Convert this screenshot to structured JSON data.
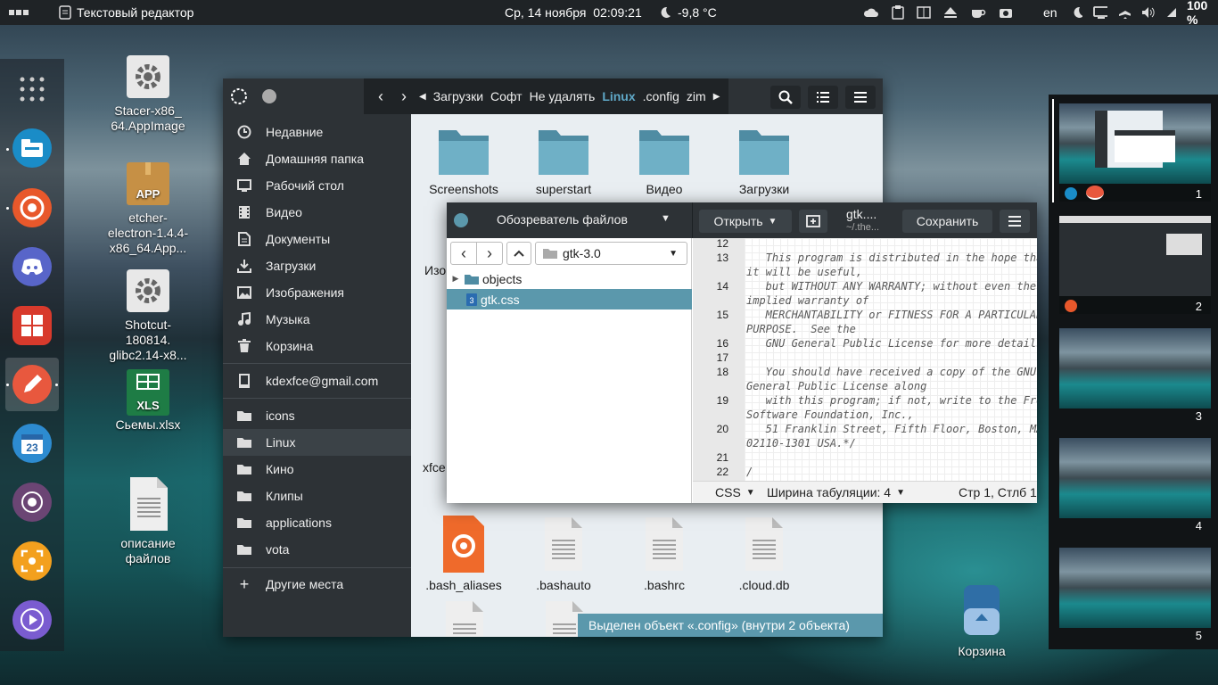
{
  "topbar": {
    "app_title": "Текстовый редактор",
    "datetime": "Ср, 14 ноября  02:09:21",
    "weather": "-9,8 °C",
    "lang": "en",
    "battery": "100 %"
  },
  "desktop": {
    "icons": [
      {
        "label": "Stacer-x86_\n64.AppImage"
      },
      {
        "label": "etcher-\nelectron-1.4.4-\nx86_64.App...",
        "badge": "APP"
      },
      {
        "label": "Shotcut-\n180814.\nglibc2.14-x8..."
      },
      {
        "label": "Сьемы.xlsx",
        "badge": "XLS"
      },
      {
        "label": "описание\nфайлов"
      }
    ],
    "trash_label": "Корзина"
  },
  "filemanager": {
    "breadcrumbs": [
      "Загрузки",
      "Софт",
      "Не удалять",
      "Linux",
      ".config",
      "zim"
    ],
    "active_crumb": "Linux",
    "sidebar": [
      {
        "label": "Недавние",
        "icon": "clock-icon"
      },
      {
        "label": "Домашняя папка",
        "icon": "home-icon"
      },
      {
        "label": "Рабочий стол",
        "icon": "desktop-icon"
      },
      {
        "label": "Видео",
        "icon": "video-icon"
      },
      {
        "label": "Документы",
        "icon": "document-icon"
      },
      {
        "label": "Загрузки",
        "icon": "download-icon"
      },
      {
        "label": "Изображения",
        "icon": "image-icon"
      },
      {
        "label": "Музыка",
        "icon": "music-icon"
      },
      {
        "label": "Корзина",
        "icon": "trash-icon"
      }
    ],
    "account": "kdexfce@gmail.com",
    "bookmarks": [
      "icons",
      "Linux",
      "Кино",
      "Клипы",
      "applications",
      "vota"
    ],
    "other_places": "Другие места",
    "folders": [
      "Screenshots",
      "superstart",
      "Видео",
      "Загрузки"
    ],
    "partial_labels": [
      "Изо",
      "xfce"
    ],
    "files": [
      ".bash_aliases",
      ".bashauto",
      ".bashrc",
      ".cloud.db"
    ],
    "status": "Выделен объект «.config» (внутри 2 объекта)"
  },
  "editor": {
    "sidebar_title": "Обозреватель файлов",
    "path": "gtk-3.0",
    "tree": [
      {
        "name": "objects",
        "type": "folder"
      },
      {
        "name": "gtk.css",
        "type": "file",
        "selected": true
      }
    ],
    "open_label": "Открыть",
    "doc_title": "gtk....",
    "doc_subtitle": "~/.the...",
    "save_label": "Сохранить",
    "gutter": [
      "12",
      "13",
      "",
      "14",
      "",
      "15",
      "",
      "16",
      "17",
      "18",
      "",
      "19",
      "",
      "20",
      "",
      "21",
      "22"
    ],
    "code": [
      "",
      "   This program is distributed in the hope that",
      "it will be useful,",
      "   but WITHOUT ANY WARRANTY; without even the",
      "implied warranty of",
      "   MERCHANTABILITY or FITNESS FOR A PARTICULAR",
      "PURPOSE.  See the",
      "   GNU General Public License for more details.",
      "",
      "   You should have received a copy of the GNU",
      "General Public License along",
      "   with this program; if not, write to the Free",
      "Software Foundation, Inc.,",
      "   51 Franklin Street, Fifth Floor, Boston, MA",
      "02110-1301 USA.*/",
      "",
      "/"
    ],
    "lang": "CSS",
    "tab_width": "Ширина табуляции: 4",
    "position": "Стр 1, Стлб 1"
  },
  "workspaces": [
    "1",
    "2",
    "3",
    "4",
    "5"
  ]
}
